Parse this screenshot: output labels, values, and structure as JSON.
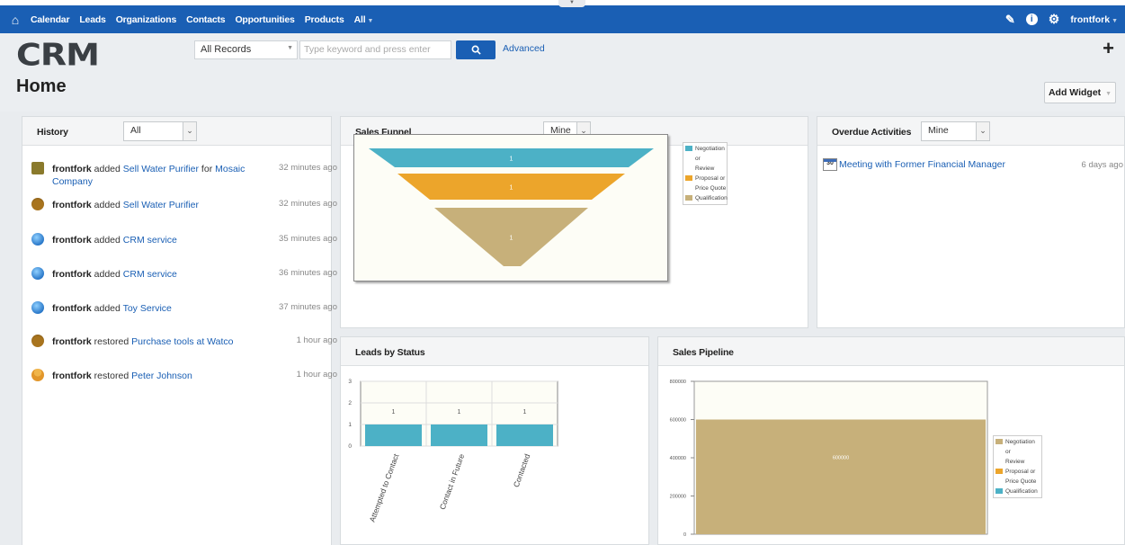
{
  "nav": {
    "items": [
      "Calendar",
      "Leads",
      "Organizations",
      "Contacts",
      "Opportunities",
      "Products",
      "All"
    ],
    "user": "frontfork"
  },
  "search": {
    "logo": "CRM",
    "scope": "All Records",
    "placeholder": "Type keyword and press enter",
    "advanced": "Advanced"
  },
  "page": {
    "title": "Home",
    "add_widget": "Add Widget"
  },
  "history": {
    "title": "History",
    "filter": "All",
    "items": [
      {
        "user": "frontfork",
        "action": "added",
        "target": "Sell Water Purifier",
        "mid": "for",
        "target2": "Mosaic Company",
        "time": "32 minutes ago",
        "icon": "opportunity-icon"
      },
      {
        "user": "frontfork",
        "action": "added",
        "target": "Sell Water Purifier",
        "time": "32 minutes ago",
        "icon": "money-bag-icon"
      },
      {
        "user": "frontfork",
        "action": "added",
        "target": "CRM service",
        "time": "35 minutes ago",
        "icon": "globe-icon"
      },
      {
        "user": "frontfork",
        "action": "added",
        "target": "CRM service",
        "time": "36 minutes ago",
        "icon": "globe-icon"
      },
      {
        "user": "frontfork",
        "action": "added",
        "target": "Toy Service",
        "time": "37 minutes ago",
        "icon": "globe-icon"
      },
      {
        "user": "frontfork",
        "action": "restored",
        "target": "Purchase tools at Watco",
        "time": "1 hour ago",
        "icon": "money-bag-icon"
      },
      {
        "user": "frontfork",
        "action": "restored",
        "target": "Peter Johnson",
        "time": "1 hour ago",
        "icon": "person-icon"
      }
    ]
  },
  "sales_funnel": {
    "title": "Sales Funnel",
    "filter": "Mine"
  },
  "overdue": {
    "title": "Overdue Activities",
    "filter": "Mine",
    "calendar_day": "30",
    "items": [
      {
        "label": "Meeting with Former Financial Manager",
        "time": "6 days ago"
      }
    ]
  },
  "leads_by_status": {
    "title": "Leads by Status"
  },
  "sales_pipeline": {
    "title": "Sales Pipeline"
  },
  "colors": {
    "teal": "#4cb1c6",
    "orange": "#eca52b",
    "tan": "#c7b07a",
    "nav": "#1a5fb4"
  },
  "chart_data": [
    {
      "type": "funnel",
      "categories": [
        "Negotiation or Review",
        "Proposal or Price Quote",
        "Qualification"
      ],
      "values": [
        1,
        1,
        1
      ],
      "legend": [
        "Negotiation or Review",
        "Proposal or Price Quote",
        "Qualification"
      ],
      "legend_position": "right"
    },
    {
      "type": "bar",
      "categories": [
        "Attempted to Contact",
        "Contact in Future",
        "Contacted"
      ],
      "values": [
        1,
        1,
        1
      ],
      "ylim": [
        0,
        3
      ],
      "yticks": [
        "0",
        "1",
        "2",
        "3"
      ]
    },
    {
      "type": "bar",
      "categories": [
        ""
      ],
      "values": [
        600000
      ],
      "data_label": "600000",
      "ylim": [
        0,
        800000
      ],
      "yticks": [
        "0",
        "200000",
        "400000",
        "600000",
        "800000"
      ],
      "legend": [
        "Negotiation or Review",
        "Proposal or Price Quote",
        "Qualification"
      ],
      "legend_position": "right"
    }
  ]
}
